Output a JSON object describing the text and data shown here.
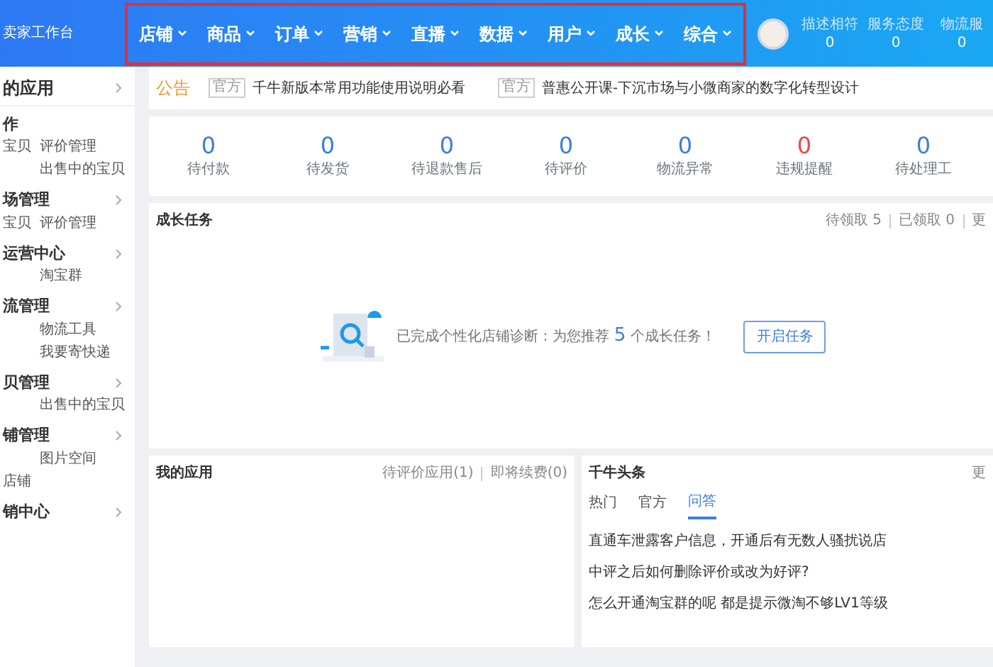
{
  "topbar": {
    "logo": "卖家工作台",
    "nav": {
      "highlighted": true,
      "items": [
        "店铺",
        "商品",
        "订单",
        "营销",
        "直播",
        "数据",
        "用户",
        "成长",
        "综合"
      ]
    },
    "metrics": [
      {
        "label": "描述相符",
        "value": "0"
      },
      {
        "label": "服务态度",
        "value": "0"
      },
      {
        "label": "物流服",
        "value": "0"
      }
    ]
  },
  "sidebar": [
    {
      "title": "的应用",
      "chevron": true
    },
    {
      "title": "作",
      "chevron": false,
      "rows": [
        {
          "left": "宝贝",
          "right": "评价管理"
        },
        {
          "right": "出售中的宝贝"
        }
      ]
    },
    {
      "title": "场管理",
      "chevron": true,
      "rows": [
        {
          "left": "宝贝",
          "right": "评价管理"
        }
      ]
    },
    {
      "title": "运营中心",
      "chevron": true,
      "rows": [
        {
          "right": "淘宝群"
        }
      ]
    },
    {
      "title": "流管理",
      "chevron": true,
      "rows": [
        {
          "right": "物流工具"
        },
        {
          "right": "我要寄快递"
        }
      ]
    },
    {
      "title": "贝管理",
      "chevron": true,
      "rows": [
        {
          "right": "出售中的宝贝"
        }
      ]
    },
    {
      "title": "铺管理",
      "chevron": true,
      "rows": [
        {
          "right": "图片空间"
        },
        {
          "left": "店铺"
        }
      ]
    },
    {
      "title": "销中心",
      "chevron": true
    }
  ],
  "notice": {
    "label": "公告",
    "items": [
      {
        "tag": "官方",
        "text": "千牛新版本常用功能使用说明必看"
      },
      {
        "tag": "官方",
        "text": "普惠公开课-下沉市场与小微商家的数字化转型设计"
      }
    ]
  },
  "stats": [
    {
      "value": "0",
      "label": "待付款",
      "alert": false
    },
    {
      "value": "0",
      "label": "待发货",
      "alert": false
    },
    {
      "value": "0",
      "label": "待退款售后",
      "alert": false
    },
    {
      "value": "0",
      "label": "待评价",
      "alert": false
    },
    {
      "value": "0",
      "label": "物流异常",
      "alert": false
    },
    {
      "value": "0",
      "label": "违规提醒",
      "alert": true
    },
    {
      "value": "0",
      "label": "待处理工",
      "alert": false
    }
  ],
  "growth": {
    "title": "成长任务",
    "links": [
      "待领取 5",
      "已领取 0",
      "更"
    ],
    "message_prefix": "已完成个性化店铺诊断：为您推荐",
    "count": "5",
    "message_suffix": "个成长任务！",
    "button": "开启任务"
  },
  "apps": {
    "title": "我的应用",
    "links": [
      "待评价应用(1)",
      "即将续费(0)"
    ]
  },
  "news": {
    "title": "千牛头条",
    "more": "更",
    "tabs": [
      {
        "label": "热门",
        "selected": false
      },
      {
        "label": "官方",
        "selected": false
      },
      {
        "label": "问答",
        "selected": true
      }
    ],
    "items": [
      "直通车泄露客户信息，开通后有无数人骚扰说店",
      "中评之后如何删除评价或改为好评?",
      "怎么开通淘宝群的呢 都是提示微淘不够LV1等级"
    ]
  }
}
